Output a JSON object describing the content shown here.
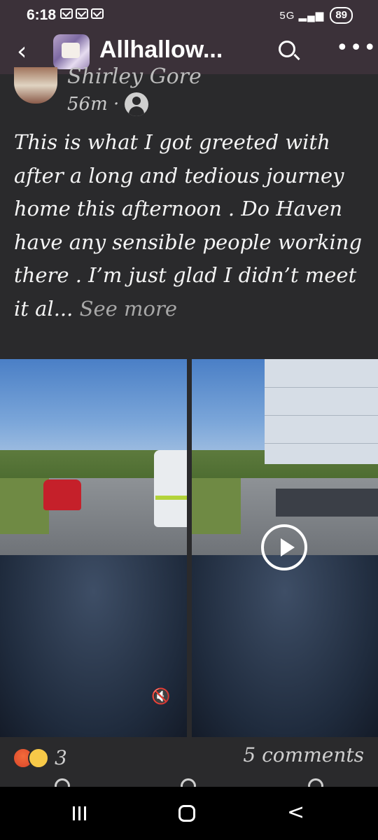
{
  "status": {
    "time": "6:18",
    "battery": "89",
    "signal": "5G ▂▄▆",
    "notification_icons": [
      "mail-icon",
      "mail-icon",
      "mail-icon"
    ]
  },
  "appbar": {
    "title": "Allhallow...",
    "back_icon": "back-arrow-icon",
    "search_icon": "search-icon",
    "more_icon": "more-options-icon"
  },
  "post": {
    "author": "Shirley Gore",
    "time": "56m ·",
    "text": "This is what I got greeted with after a long and tedious journey home this afternoon . Do Haven have any sensible people working there . I’m just glad I didn’t meet it al...",
    "see_more": "See more"
  },
  "media": {
    "mute_icon": "muted-speaker-icon",
    "mute_glyph": "🔇",
    "play_icon": "play-icon"
  },
  "footer": {
    "reaction_count": "3",
    "comments": "5 comments"
  },
  "nav": {
    "recents": "recents-icon",
    "home": "home-icon",
    "back_glyph": "<"
  }
}
